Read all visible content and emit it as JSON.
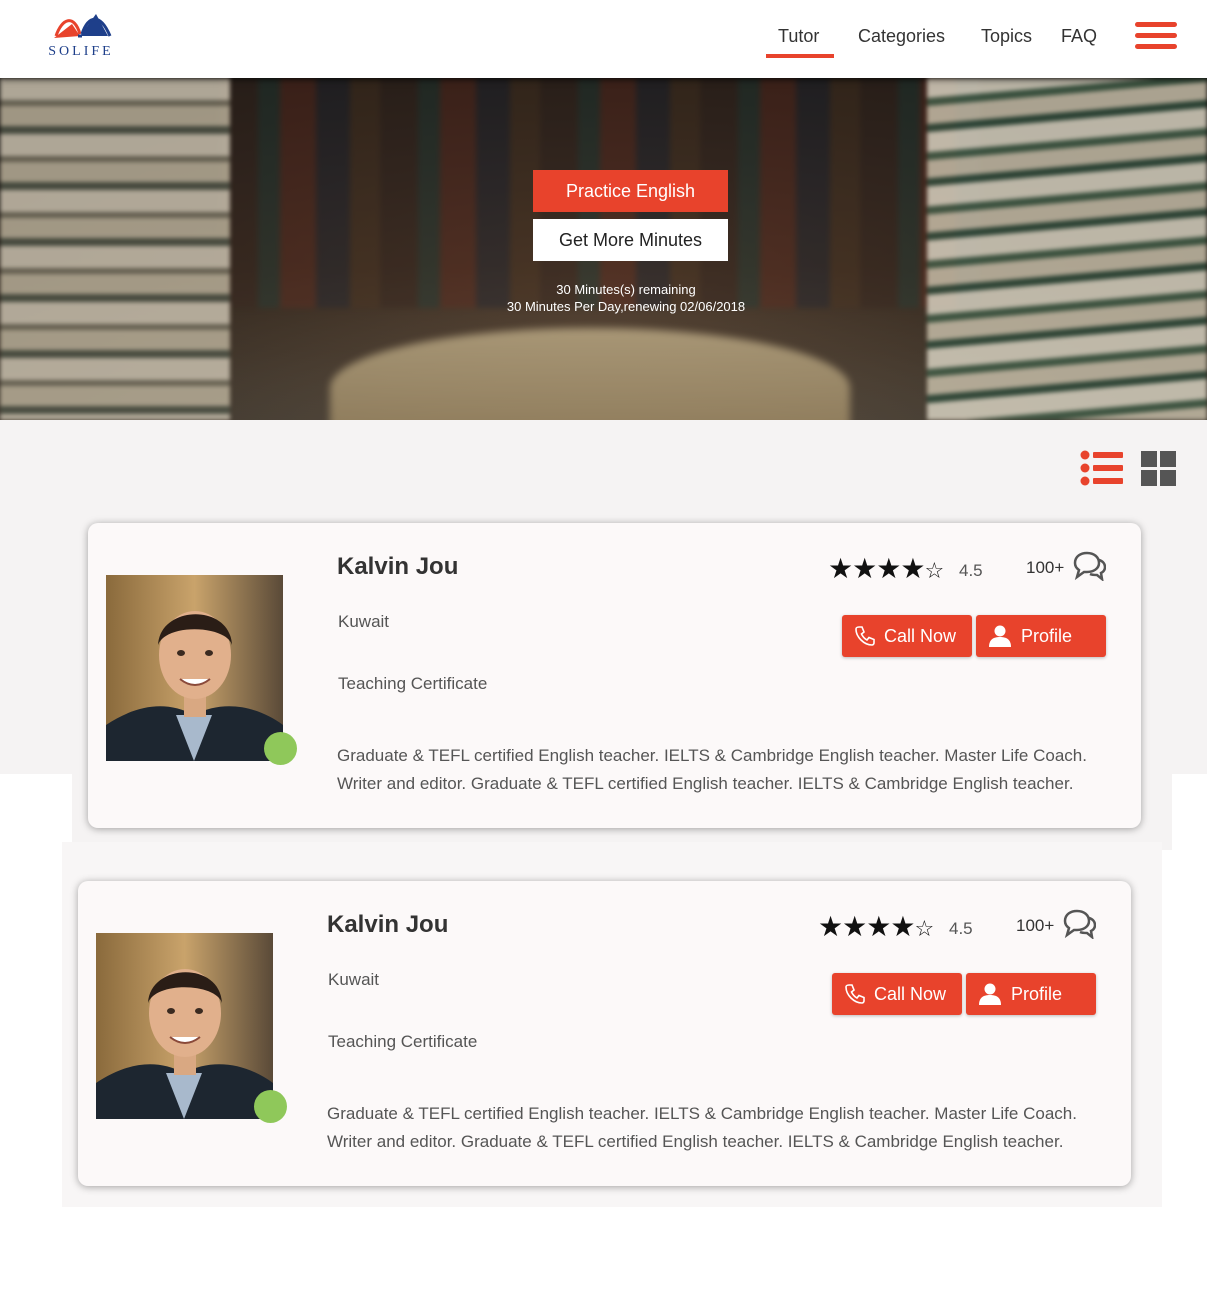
{
  "brand": {
    "name": "SOLIFE"
  },
  "nav": {
    "items": [
      "Tutor",
      "Categories",
      "Topics",
      "FAQ"
    ],
    "active": "Tutor"
  },
  "hero": {
    "practice_label": "Practice English",
    "minutes_label": "Get More Minutes",
    "remaining_text": "30 Minutes(s) remaining",
    "renewal_text": "30 Minutes Per Day,renewing 02/06/2018"
  },
  "colors": {
    "accent": "#e8432c",
    "online": "#8fc85a",
    "brand_blue": "#1e3f8a"
  },
  "icons": {
    "menu": "hamburger-icon",
    "list_view": "list-view-icon",
    "grid_view": "grid-view-icon",
    "chat": "chat-bubbles-icon",
    "phone": "phone-icon",
    "user": "user-icon"
  },
  "tutors": [
    {
      "name": "Kalvin Jou",
      "location": "Kuwait",
      "certificate": "Teaching Certificate",
      "description_line1": "Graduate & TEFL certified English teacher. IELTS & Cambridge English teacher. Master Life Coach.",
      "description_line2": "Writer and editor. Graduate & TEFL certified English teacher. IELTS & Cambridge English teacher.",
      "stars": 4,
      "rating": "4.5",
      "reviews": "100+",
      "call_label": "Call Now",
      "profile_label": "Profile",
      "online": true
    },
    {
      "name": "Kalvin Jou",
      "location": "Kuwait",
      "certificate": "Teaching Certificate",
      "description_line1": "Graduate & TEFL certified English teacher. IELTS & Cambridge English teacher. Master Life Coach.",
      "description_line2": "Writer and editor. Graduate & TEFL certified English teacher. IELTS & Cambridge English teacher.",
      "stars": 4,
      "rating": "4.5",
      "reviews": "100+",
      "call_label": "Call Now",
      "profile_label": "Profile",
      "online": true
    }
  ]
}
